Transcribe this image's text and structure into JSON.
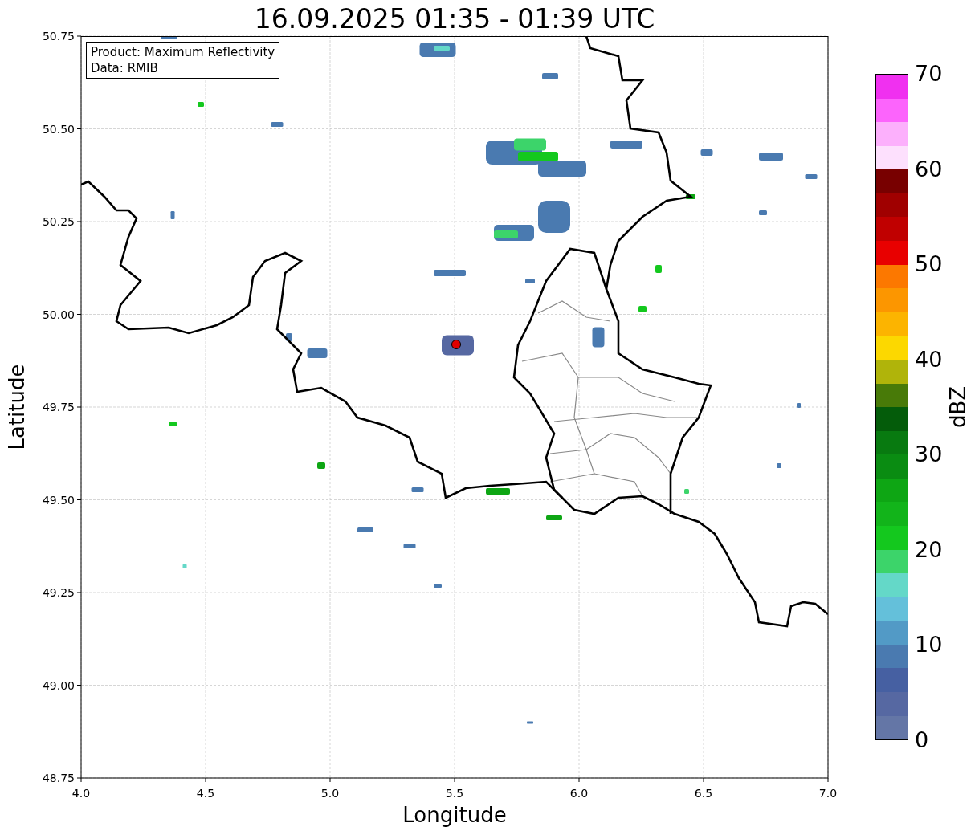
{
  "title": "16.09.2025 01:35 - 01:39 UTC",
  "legend": {
    "lines": [
      "Product: Maximum Reflectivity",
      "Data: RMIB"
    ]
  },
  "x_axis": {
    "label": "Longitude",
    "ticks": [
      "4.0",
      "4.5",
      "5.0",
      "5.5",
      "6.0",
      "6.5",
      "7.0"
    ]
  },
  "y_axis": {
    "label": "Latitude",
    "ticks": [
      "50.75",
      "50.50",
      "50.25",
      "50.00",
      "49.75",
      "49.50",
      "49.25",
      "49.00",
      "48.75"
    ]
  },
  "colorbar": {
    "label": "dBZ",
    "ticks": [
      "70",
      "60",
      "50",
      "40",
      "30",
      "20",
      "10",
      "0"
    ],
    "segments": [
      {
        "color": "#f030f0"
      },
      {
        "color": "#fc64fc"
      },
      {
        "color": "#fcb0fc"
      },
      {
        "color": "#fde0fd"
      },
      {
        "color": "#780000"
      },
      {
        "color": "#a00000"
      },
      {
        "color": "#c00000"
      },
      {
        "color": "#e80000"
      },
      {
        "color": "#fc7800"
      },
      {
        "color": "#fc9600"
      },
      {
        "color": "#fcb400"
      },
      {
        "color": "#fcd800"
      },
      {
        "color": "#b0b40a"
      },
      {
        "color": "#487a08"
      },
      {
        "color": "#045c0a"
      },
      {
        "color": "#087a10"
      },
      {
        "color": "#0a8c12"
      },
      {
        "color": "#0ea614"
      },
      {
        "color": "#12b41a"
      },
      {
        "color": "#14c81e"
      },
      {
        "color": "#3cd46a"
      },
      {
        "color": "#64d8c8"
      },
      {
        "color": "#64c0da"
      },
      {
        "color": "#529ac6"
      },
      {
        "color": "#4a7ab0"
      },
      {
        "color": "#4660a2"
      },
      {
        "color": "#5668a2"
      },
      {
        "color": "#6476a6"
      }
    ]
  }
}
